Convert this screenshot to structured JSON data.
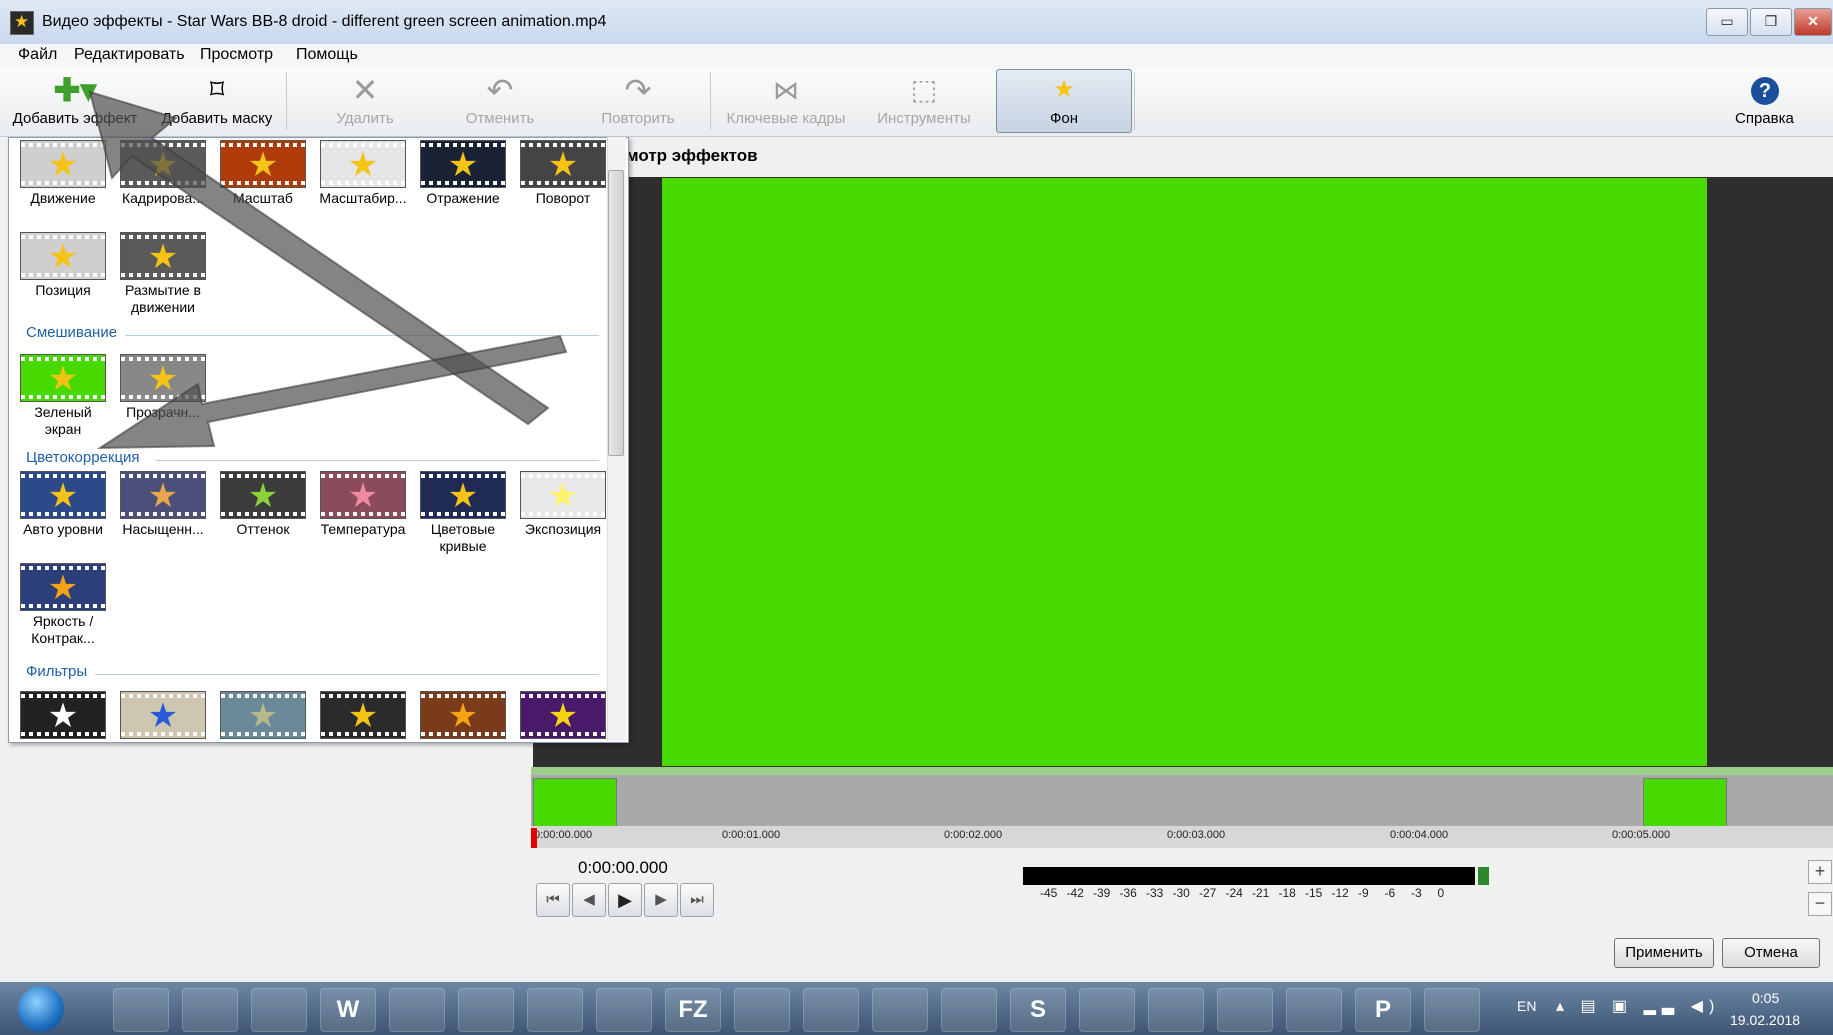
{
  "window": {
    "title": "Видео эффекты - Star Wars BB-8 droid - different green screen animation.mp4",
    "controls": {
      "minimize": "▭",
      "maximize": "❐",
      "close": "✕"
    }
  },
  "menu": [
    "Файл",
    "Редактировать",
    "Просмотр",
    "Помощь"
  ],
  "toolbar": {
    "add_effect": "Добавить эффект",
    "add_mask": "Добавить маску",
    "delete": "Удалить",
    "undo": "Отменить",
    "redo": "Повторить",
    "keyframes": "Ключевые кадры",
    "tools": "Инструменты",
    "background": "Фон",
    "help": "Справка"
  },
  "effects_panel": {
    "motion_items": [
      {
        "label": "Движение",
        "icon": "motion-star"
      },
      {
        "label": "Кадрирова...",
        "icon": "crop-star"
      },
      {
        "label": "Масштаб",
        "icon": "scale-star"
      },
      {
        "label": "Масштабир...",
        "icon": "zoom-star"
      },
      {
        "label": "Отражение",
        "icon": "mirror-star"
      },
      {
        "label": "Поворот",
        "icon": "rotate-star"
      },
      {
        "label": "Позиция",
        "icon": "position-star"
      },
      {
        "label": "Размытие в движении",
        "icon": "motion-blur-star"
      }
    ],
    "blend_category": "Смешивание",
    "blend_items": [
      {
        "label": "Зеленый экран",
        "icon": "green-screen-star"
      },
      {
        "label": "Прозрачн...",
        "icon": "transparency-star"
      }
    ],
    "color_category": "Цветокоррекция",
    "color_items": [
      {
        "label": "Авто уровни",
        "icon": "auto-levels-star"
      },
      {
        "label": "Насыщенн...",
        "icon": "saturation-star"
      },
      {
        "label": "Оттенок",
        "icon": "hue-star"
      },
      {
        "label": "Температура",
        "icon": "temperature-star"
      },
      {
        "label": "Цветовые кривые",
        "icon": "curves-star"
      },
      {
        "label": "Экспозиция",
        "icon": "exposure-star"
      },
      {
        "label": "Яркость / Контрак...",
        "icon": "brightness-star"
      }
    ],
    "filters_category": "Фильтры"
  },
  "preview": {
    "title": "мотр эффектов",
    "background_color": "#48d900"
  },
  "timeline": {
    "ticks": [
      "0:00:00.000",
      "0:00:01.000",
      "0:00:02.000",
      "0:00:03.000",
      "0:00:04.000",
      "0:00:05.000"
    ],
    "timecode": "0:00:00.000"
  },
  "transport": {
    "to_start": "⏮",
    "prev_frame": "◀",
    "play": "▶",
    "next_frame": "▶",
    "to_end": "⏭"
  },
  "audio_meter": {
    "scale": [
      "-45",
      "-42",
      "-39",
      "-36",
      "-33",
      "-30",
      "-27",
      "-24",
      "-21",
      "-18",
      "-15",
      "-12",
      "-9",
      "-6",
      "-3",
      "0"
    ]
  },
  "zoom": {
    "in": "+",
    "out": "−"
  },
  "dialog": {
    "apply": "Применить",
    "cancel": "Отмена"
  },
  "taskbar": {
    "apps": [
      "explorer-tiles",
      "notes",
      "media-player",
      "W",
      "firefox",
      "chrome",
      "audio",
      "python",
      "FZ",
      "file-manager",
      "globe",
      "box",
      "tools",
      "S",
      "notepad",
      "eye",
      "browser",
      "video-editor",
      "P",
      "flower"
    ],
    "tray_lang": "EN",
    "time": "0:05",
    "date": "19.02.2018"
  },
  "colors": {
    "accent": "#1f5fa6",
    "green_screen": "#48d900",
    "playhead": "#e00000"
  }
}
